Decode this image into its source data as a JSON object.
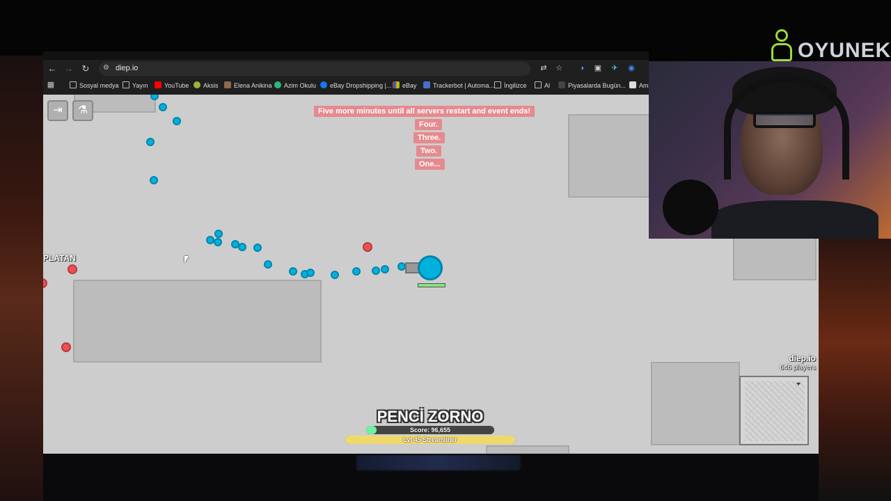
{
  "browser": {
    "url": "diep.io",
    "bookmarks": [
      "Sosyal medya",
      "Yayın",
      "YouTube",
      "Aksis",
      "Elena Anikina",
      "Azim Okulu",
      "eBay Dropshipping |...",
      "eBay",
      "Trackerbot | Automa...",
      "İngilizce",
      "Al",
      "Piyasalarda Bugün...",
      "Ama"
    ]
  },
  "overlay": {
    "logo_text": "OYUNEKS"
  },
  "game": {
    "messages": [
      "Five more minutes until all servers restart and event ends!",
      "Four.",
      "Three.",
      "Two.",
      "One..."
    ],
    "other_player": "PLATAN",
    "player_name": "PENCİ ZORNO",
    "score": "Score: 96,655",
    "level": "Lvl 45 Streamliner",
    "brand": "diep.io",
    "players_online": "646 players",
    "score_progress": 0.08,
    "level_progress": 1.0
  },
  "colors": {
    "team_blue": "#00b1de",
    "enemy_red": "#f14e54",
    "arena_bg": "#cdcdcd",
    "msg_bg": "#e58a8e"
  }
}
